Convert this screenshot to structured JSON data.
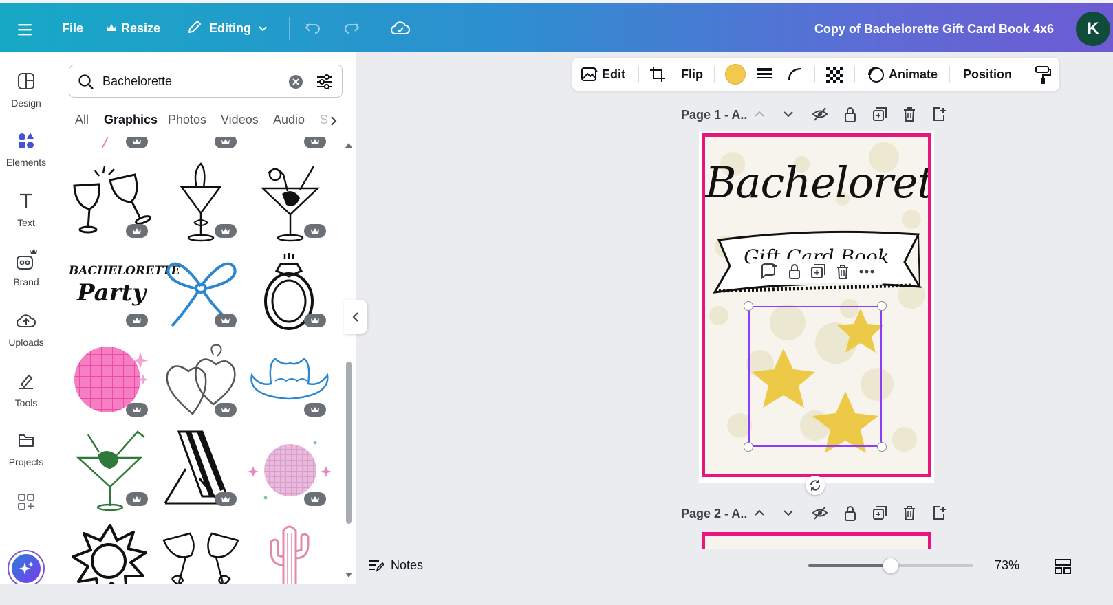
{
  "topbar": {
    "file_label": "File",
    "resize_label": "Resize",
    "editing_label": "Editing",
    "doc_title": "Copy of Bachelorette Gift Card Book 4x6",
    "avatar_initial": "K",
    "gradient_start": "#16a9c6",
    "gradient_end": "#6d5bd3"
  },
  "rail": {
    "items": [
      {
        "label": "Design",
        "icon": "design-icon"
      },
      {
        "label": "Elements",
        "icon": "elements-icon"
      },
      {
        "label": "Text",
        "icon": "text-icon"
      },
      {
        "label": "Brand",
        "icon": "brand-icon"
      },
      {
        "label": "Uploads",
        "icon": "uploads-icon"
      },
      {
        "label": "Tools",
        "icon": "tools-icon"
      },
      {
        "label": "Projects",
        "icon": "projects-icon"
      }
    ],
    "active": "Elements"
  },
  "panel": {
    "search_value": "Bachelorette",
    "tabs": [
      "All",
      "Graphics",
      "Photos",
      "Videos",
      "Audio",
      "S"
    ],
    "active_tab": "Graphics",
    "thumbnails": [
      "cheers-wine-glasses",
      "martini-mermaid",
      "woman-in-martini-glass",
      "bachelorette-party-lettering",
      "blue-bow",
      "diamond-ring",
      "pink-disco-ball",
      "linked-hearts",
      "blue-cowboy-hat",
      "pin-up-in-martini",
      "striped-beach-chair",
      "pastel-disco-ball",
      "sun-doodle",
      "champagne-coupes-bows",
      "pink-cactus"
    ],
    "bachelorette_party_text_1": "BACHELORETTE",
    "bachelorette_party_text_2": "Party"
  },
  "context_toolbar": {
    "edit_label": "Edit",
    "flip_label": "Flip",
    "animate_label": "Animate",
    "position_label": "Position",
    "fill_color": "#f2c94c"
  },
  "pages": {
    "page1_label": "Page 1 - A..",
    "page2_label": "Page 2 - A..",
    "page1_title": "Bachelorette",
    "banner_text": "Gift Card Book",
    "border_color": "#e7157c",
    "star_color": "#ecca48"
  },
  "bottom": {
    "notes_label": "Notes",
    "zoom_percent": "73%",
    "zoom_level": 0.5
  }
}
